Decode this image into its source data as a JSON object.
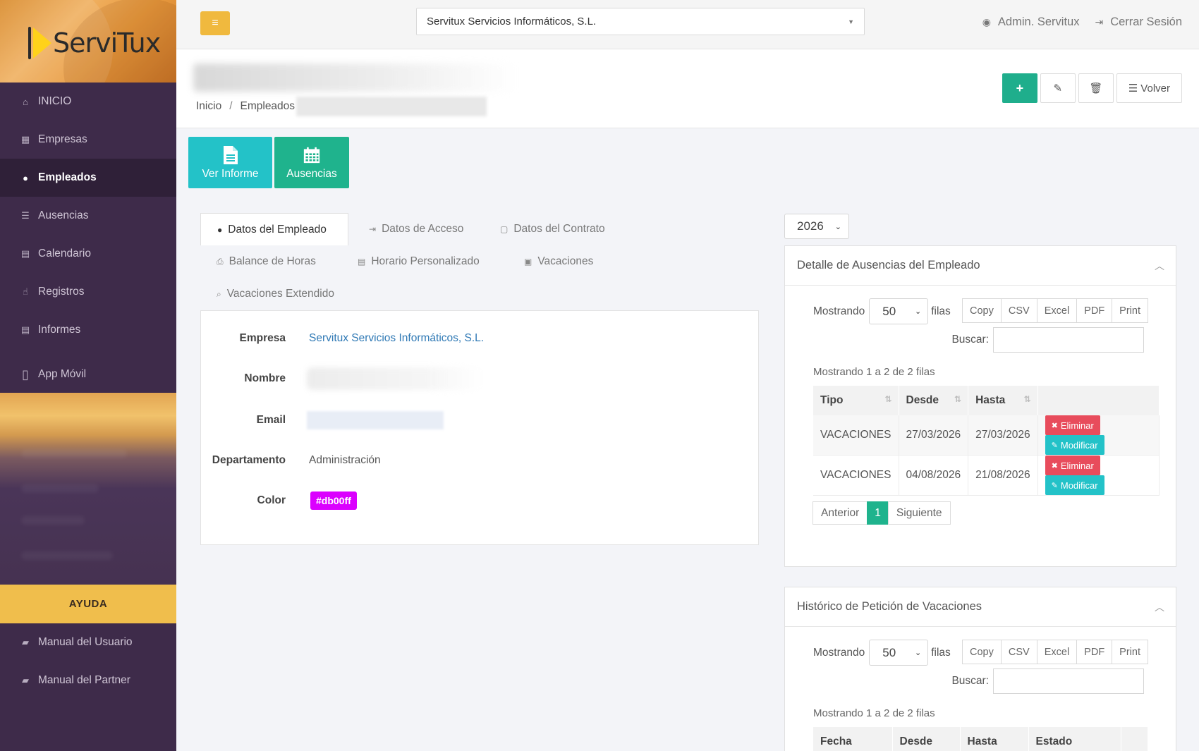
{
  "brand": {
    "name": "ServiTux"
  },
  "sidebar": {
    "items": [
      {
        "icon": "home-icon",
        "label": "INICIO"
      },
      {
        "icon": "building-icon",
        "label": "Empresas"
      },
      {
        "icon": "users-icon",
        "label": "Empleados"
      },
      {
        "icon": "list-icon",
        "label": "Ausencias"
      },
      {
        "icon": "calendar-icon",
        "label": "Calendario"
      },
      {
        "icon": "hand-icon",
        "label": "Registros"
      },
      {
        "icon": "file-icon",
        "label": "Informes"
      },
      {
        "icon": "mobile-icon",
        "label": "App Móvil"
      }
    ],
    "help_title": "AYUDA",
    "help_items": [
      {
        "icon": "book-icon",
        "label": "Manual del Usuario"
      },
      {
        "icon": "book-icon",
        "label": "Manual del Partner"
      }
    ]
  },
  "topbar": {
    "company": "Servitux Servicios Informáticos, S.L.",
    "user": "Admin. Servitux",
    "logout": "Cerrar Sesión"
  },
  "breadcrumb": {
    "home": "Inicio",
    "section": "Empleados"
  },
  "header_actions": {
    "back": "Volver"
  },
  "tiles": {
    "report": "Ver Informe",
    "absences": "Ausencias"
  },
  "tabs": {
    "datos_empleado": "Datos del Empleado",
    "datos_acceso": "Datos de Acceso",
    "datos_contrato": "Datos del Contrato",
    "balance_horas": "Balance de Horas",
    "horario": "Horario Personalizado",
    "vacaciones": "Vacaciones",
    "vacaciones_ext": "Vacaciones Extendido"
  },
  "employee": {
    "empresa_label": "Empresa",
    "empresa": "Servitux Servicios Informáticos, S.L.",
    "nombre_label": "Nombre",
    "email_label": "Email",
    "departamento_label": "Departamento",
    "departamento": "Administración",
    "color_label": "Color",
    "color": "#db00ff"
  },
  "year": "2026",
  "absences_card": {
    "title": "Detalle de Ausencias del Empleado",
    "showing": "Mostrando",
    "length": "50",
    "rows_word": "filas",
    "export": [
      "Copy",
      "CSV",
      "Excel",
      "PDF",
      "Print"
    ],
    "search_label": "Buscar:",
    "info": "Mostrando 1 a 2 de 2 filas",
    "columns": [
      "Tipo",
      "Desde",
      "Hasta"
    ],
    "rows": [
      {
        "tipo": "VACACIONES",
        "desde": "27/03/2026",
        "hasta": "27/03/2026"
      },
      {
        "tipo": "VACACIONES",
        "desde": "04/08/2026",
        "hasta": "21/08/2026"
      }
    ],
    "delete_label": "Eliminar",
    "modify_label": "Modificar",
    "prev": "Anterior",
    "page": "1",
    "next": "Siguiente"
  },
  "vacation_card": {
    "title": "Histórico de Petición de Vacaciones",
    "showing": "Mostrando",
    "length": "50",
    "rows_word": "filas",
    "export": [
      "Copy",
      "CSV",
      "Excel",
      "PDF",
      "Print"
    ],
    "search_label": "Buscar:",
    "info": "Mostrando 1 a 2 de 2 filas",
    "columns": [
      "Fecha",
      "Desde",
      "Hasta",
      "Estado"
    ]
  }
}
